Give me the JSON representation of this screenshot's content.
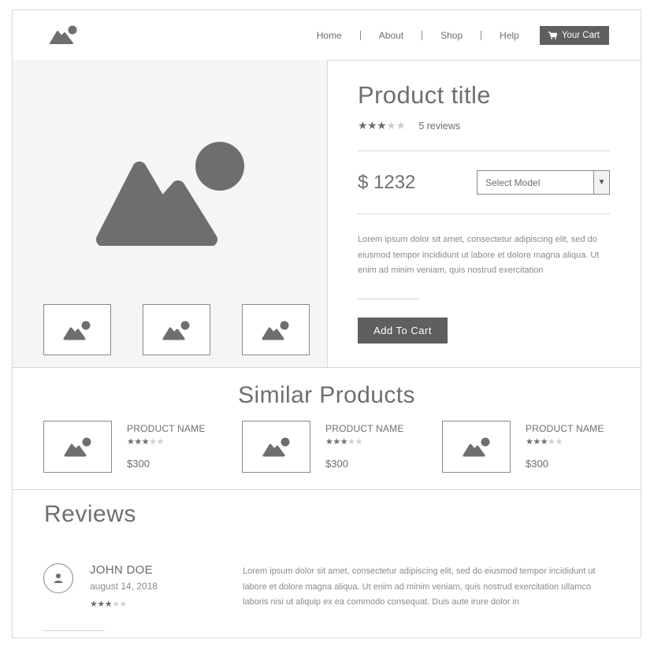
{
  "nav": {
    "items": [
      "Home",
      "About",
      "Shop",
      "Help"
    ],
    "cart_label": "Your Cart"
  },
  "product": {
    "title": "Product title",
    "rating": 3,
    "rating_max": 5,
    "reviews_label": "5 reviews",
    "price": "$ 1232",
    "select_placeholder": "Select Model",
    "description": "Lorem ipsum dolor sit amet, consectetur adipiscing elit, sed do eiusmod tempor incididunt ut labore et dolore magna aliqua. Ut enim ad minim veniam, quis nostrud exercitation",
    "add_to_cart_label": "Add To Cart",
    "thumbnail_count": 3
  },
  "similar": {
    "title": "Similar Products",
    "items": [
      {
        "name": "PRODUCT NAME",
        "rating": 3,
        "price": "$300"
      },
      {
        "name": "PRODUCT NAME",
        "rating": 3,
        "price": "$300"
      },
      {
        "name": "PRODUCT NAME",
        "rating": 3,
        "price": "$300"
      }
    ]
  },
  "reviews": {
    "title": "Reviews",
    "items": [
      {
        "name": "JOHN DOE",
        "date": "august 14, 2018",
        "rating": 3,
        "text": "Lorem ipsum dolor sit amet, consectetur adipiscing elit, sed do eiusmod tempor incididunt ut labore et dolore magna aliqua. Ut enim ad minim veniam, quis nostrud exercitation ullamco laboris nisi ut aliquip ex ea commodo consequat. Duis aute irure dolor in"
      }
    ]
  },
  "icons": {
    "logo": "mountain-sun-icon",
    "cart": "cart-icon",
    "image_placeholder": "image-placeholder-icon",
    "user": "user-icon",
    "dropdown": "chevron-down-icon"
  },
  "colors": {
    "button": "#5f5f5f",
    "gallery_bg": "#f5f5f5",
    "border": "#d6d6d6",
    "star_on": "#6e6e6e",
    "star_off": "#cfcfcf"
  }
}
